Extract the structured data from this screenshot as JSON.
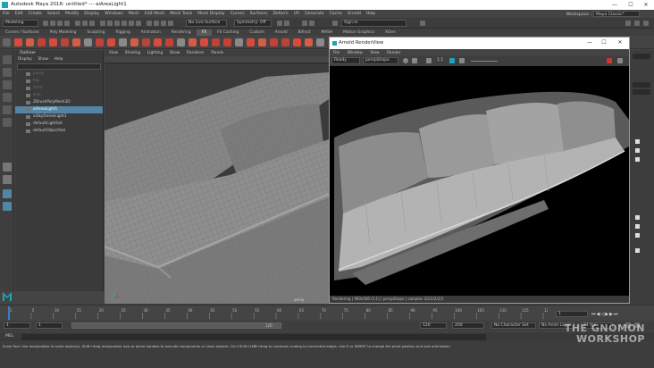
{
  "window": {
    "title": "Autodesk Maya 2018: untitled*   ---   aiAreaLight1",
    "controls": [
      "—",
      "☐",
      "✕"
    ]
  },
  "menubar": [
    "File",
    "Edit",
    "Create",
    "Select",
    "Modify",
    "Display",
    "Windows",
    "Mesh",
    "Edit Mesh",
    "Mesh Tools",
    "Mesh Display",
    "Curves",
    "Surfaces",
    "Deform",
    "UV",
    "Generate",
    "Cache",
    "Arnold",
    "Help"
  ],
  "workspace": {
    "label": "Workspace :",
    "value": "Maya Classic*"
  },
  "statusline": {
    "mode": "Modeling",
    "live": "No Live Surface",
    "symmetry": "Symmetry: Off",
    "signin": "Sign In"
  },
  "shelf_tabs": [
    "Curves / Surfaces",
    "Poly Modeling",
    "Sculpting",
    "Rigging",
    "Animation",
    "Rendering",
    "FX",
    "FX Caching",
    "Custom",
    "Arnold",
    "Bifrost",
    "MASH",
    "Motion Graphics",
    "XGen"
  ],
  "active_shelf": "FX",
  "outliner": {
    "title": "Outliner",
    "menus": [
      "Display",
      "Show",
      "Help"
    ],
    "items": [
      {
        "label": "persp",
        "dim": true
      },
      {
        "label": "top",
        "dim": true
      },
      {
        "label": "front",
        "dim": true
      },
      {
        "label": "side",
        "dim": true
      },
      {
        "label": "ZBrushPolyMesh3D",
        "dim": false
      },
      {
        "label": "aiAreaLight1",
        "dim": false,
        "selected": true
      },
      {
        "label": "aiSkyDomeLight1",
        "dim": false
      },
      {
        "label": "defaultLightSet",
        "dim": false
      },
      {
        "label": "defaultObjectSet",
        "dim": false
      }
    ]
  },
  "viewport": {
    "menus": [
      "View",
      "Shading",
      "Lighting",
      "Show",
      "Renderer",
      "Panels"
    ],
    "camera": "persp"
  },
  "renderview": {
    "title": "Arnold RenderView",
    "menus": [
      "File",
      "Window",
      "View",
      "Render"
    ],
    "state": "Ready",
    "camera": "perspShape",
    "ratio": "1:1",
    "status": "Rendering  |  960x540 (1:1)  |  perspShape  |  samples 3/2/2/2/2/2"
  },
  "timeline": {
    "ticks": [
      "1",
      "5",
      "10",
      "15",
      "20",
      "25",
      "30",
      "35",
      "40",
      "45",
      "50",
      "55",
      "60",
      "65",
      "70",
      "75",
      "80",
      "85",
      "90",
      "95",
      "100",
      "105",
      "110",
      "115",
      "120"
    ],
    "current": "1"
  },
  "range": {
    "start": "1",
    "start2": "1",
    "mid": "120",
    "end": "120",
    "end2": "200",
    "character": "No Character Set",
    "anim_layer": "No Anim Layer",
    "fps": "24 fps"
  },
  "cmd": {
    "lang": "MEL"
  },
  "help": {
    "text": "Scale Tool: Use manipulator to scale object(s). Shift+drag manipulator axis or plane handles to extrude components or clone objects. Ctrl+Shift+LMB+drag to constrain scaling to connected edges. Use D or INSERT to change the pivot position and axis orientation."
  },
  "watermark": {
    "line1": "THE GNOMON",
    "line2": "WORKSHOP"
  },
  "colors": {
    "selection": "#5285a6",
    "maya_logo": "#1aa6b7"
  }
}
